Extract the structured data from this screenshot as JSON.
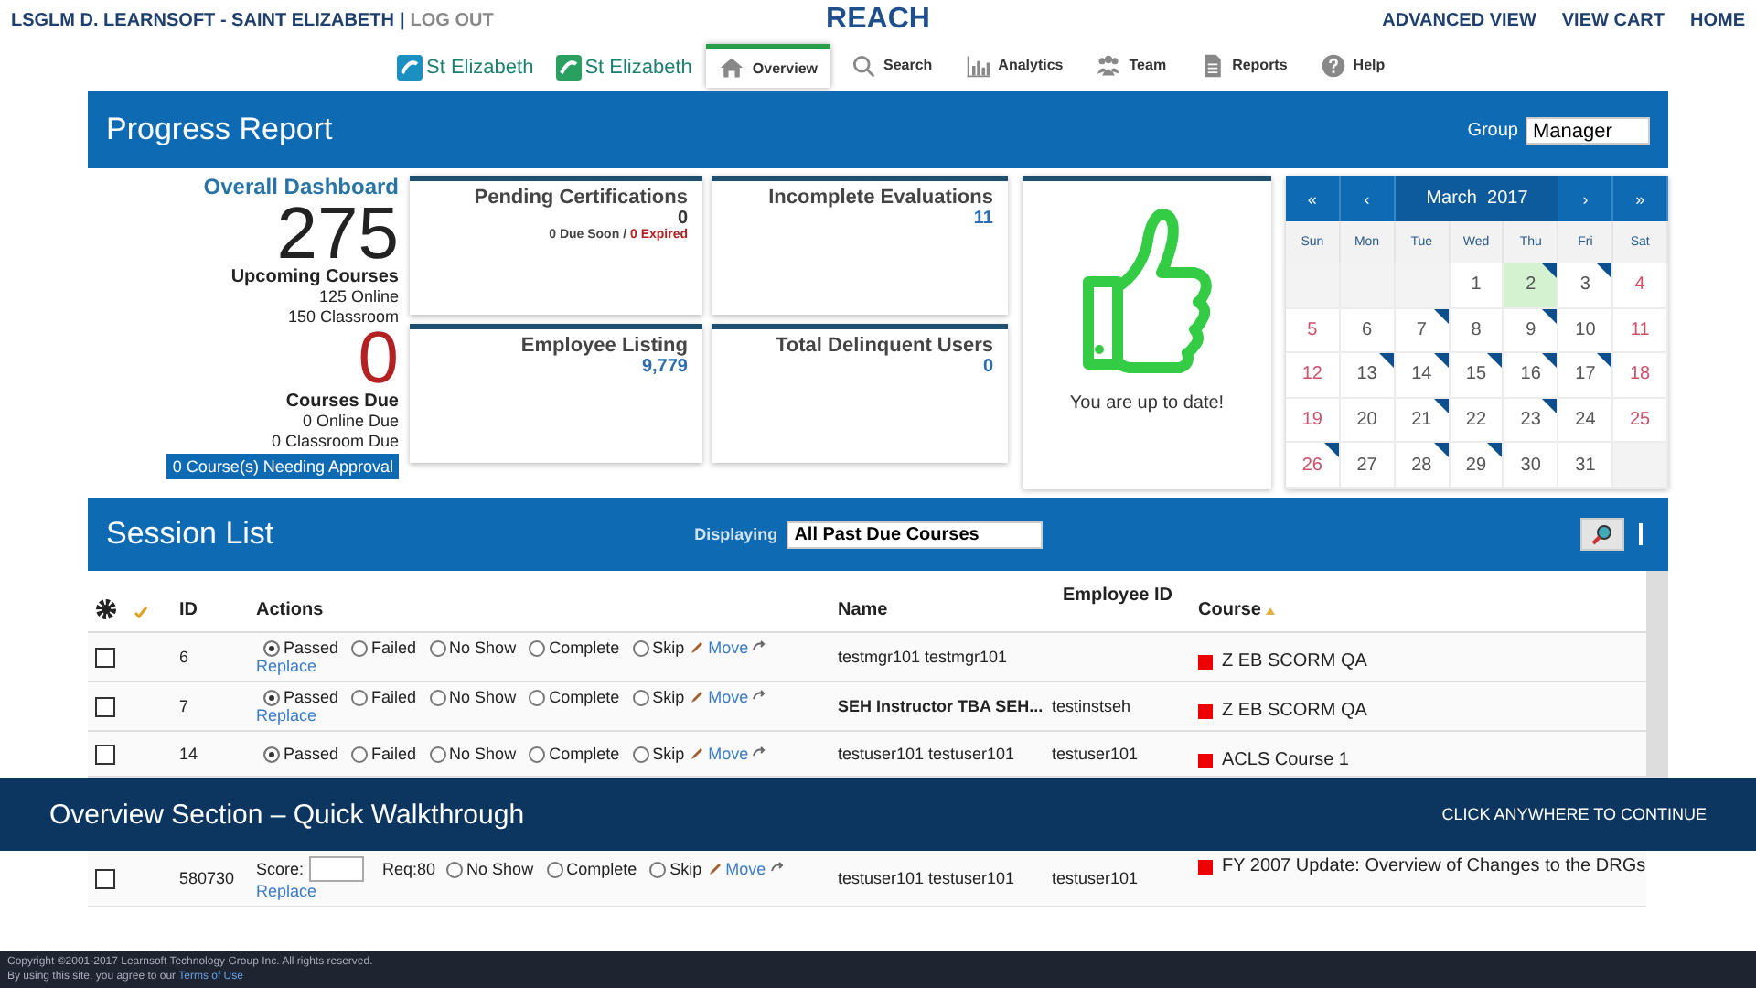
{
  "top_bar": {
    "user": "LSGLM D. LEARNSOFT - SAINT ELIZABETH",
    "separator": "|",
    "logout": "LOG OUT",
    "app_title": "REACH",
    "links": [
      "ADVANCED VIEW",
      "VIEW CART",
      "HOME"
    ]
  },
  "logos": [
    "St Elizabeth",
    "St Elizabeth"
  ],
  "nav": [
    {
      "label": "Overview",
      "kind": "home",
      "selected": true
    },
    {
      "label": "Search",
      "kind": "search",
      "selected": false
    },
    {
      "label": "Analytics",
      "kind": "chart",
      "selected": false
    },
    {
      "label": "Team",
      "kind": "team",
      "selected": false
    },
    {
      "label": "Reports",
      "kind": "document",
      "selected": false
    },
    {
      "label": "Help",
      "kind": "help",
      "selected": false
    }
  ],
  "progress_report": {
    "title": "Progress Report",
    "group_label": "Group",
    "group_value": "Manager"
  },
  "overall": {
    "title": "Overall Dashboard",
    "upcoming_count": "275",
    "upcoming_label": "Upcoming Courses",
    "online": "125 Online",
    "classroom": "150 Classroom",
    "due_count": "0",
    "due_label": "Courses Due",
    "online_due": "0 Online Due",
    "classroom_due": "0 Classroom Due",
    "approval": "0 Course(s) Needing Approval"
  },
  "cards": [
    {
      "title": "Pending Certifications",
      "value": "0",
      "kind": "plain",
      "due_soon": "0 Due Soon",
      "separator": "/",
      "expired": "0 Expired"
    },
    {
      "title": "Incomplete Evaluations",
      "value": "11",
      "kind": "link"
    },
    {
      "title": "Employee Listing",
      "value": "9,779",
      "kind": "link"
    },
    {
      "title": "Total Delinquent Users",
      "value": "0",
      "kind": "link"
    }
  ],
  "status": {
    "message": "You are up to date!"
  },
  "calendar": {
    "prev_year": "«",
    "prev": "‹",
    "month": "March  2017",
    "next": "›",
    "next_year": "»",
    "weekdays": [
      "Sun",
      "Mon",
      "Tue",
      "Wed",
      "Thu",
      "Fri",
      "Sat"
    ],
    "weeks": [
      [
        {
          "kind": "blank"
        },
        {
          "kind": "blank"
        },
        {
          "kind": "blank"
        },
        {
          "kind": "day",
          "day": "1",
          "marked": false,
          "today": false
        },
        {
          "kind": "day",
          "day": "2",
          "marked": true,
          "today": true
        },
        {
          "kind": "day",
          "day": "3",
          "marked": true,
          "today": false
        },
        {
          "kind": "day",
          "day": "4",
          "marked": false,
          "today": false
        }
      ],
      [
        {
          "kind": "day",
          "day": "5",
          "marked": false,
          "today": false
        },
        {
          "kind": "day",
          "day": "6",
          "marked": false,
          "today": false
        },
        {
          "kind": "day",
          "day": "7",
          "marked": true,
          "today": false
        },
        {
          "kind": "day",
          "day": "8",
          "marked": false,
          "today": false
        },
        {
          "kind": "day",
          "day": "9",
          "marked": true,
          "today": false
        },
        {
          "kind": "day",
          "day": "10",
          "marked": false,
          "today": false
        },
        {
          "kind": "day",
          "day": "11",
          "marked": false,
          "today": false
        }
      ],
      [
        {
          "kind": "day",
          "day": "12",
          "marked": false,
          "today": false
        },
        {
          "kind": "day",
          "day": "13",
          "marked": true,
          "today": false
        },
        {
          "kind": "day",
          "day": "14",
          "marked": true,
          "today": false
        },
        {
          "kind": "day",
          "day": "15",
          "marked": true,
          "today": false
        },
        {
          "kind": "day",
          "day": "16",
          "marked": true,
          "today": false
        },
        {
          "kind": "day",
          "day": "17",
          "marked": true,
          "today": false
        },
        {
          "kind": "day",
          "day": "18",
          "marked": false,
          "today": false
        }
      ],
      [
        {
          "kind": "day",
          "day": "19",
          "marked": false,
          "today": false
        },
        {
          "kind": "day",
          "day": "20",
          "marked": false,
          "today": false
        },
        {
          "kind": "day",
          "day": "21",
          "marked": true,
          "today": false
        },
        {
          "kind": "day",
          "day": "22",
          "marked": false,
          "today": false
        },
        {
          "kind": "day",
          "day": "23",
          "marked": true,
          "today": false
        },
        {
          "kind": "day",
          "day": "24",
          "marked": false,
          "today": false
        },
        {
          "kind": "day",
          "day": "25",
          "marked": false,
          "today": false
        }
      ],
      [
        {
          "kind": "day",
          "day": "26",
          "marked": true,
          "today": false
        },
        {
          "kind": "day",
          "day": "27",
          "marked": false,
          "today": false
        },
        {
          "kind": "day",
          "day": "28",
          "marked": true,
          "today": false
        },
        {
          "kind": "day",
          "day": "29",
          "marked": true,
          "today": false
        },
        {
          "kind": "day",
          "day": "30",
          "marked": false,
          "today": false
        },
        {
          "kind": "day",
          "day": "31",
          "marked": false,
          "today": false
        },
        {
          "kind": "blank"
        }
      ]
    ]
  },
  "session_list": {
    "title": "Session List",
    "displaying_label": "Displaying",
    "displaying_value": "All Past Due Courses",
    "columns": [
      "ID",
      "Actions",
      "Name",
      "Employee ID",
      "Course"
    ],
    "rows": [
      {
        "kind": "radios",
        "checked": false,
        "id": "6",
        "options": [
          {
            "label": "Passed",
            "selected": true
          },
          {
            "label": "Failed",
            "selected": false
          },
          {
            "label": "No Show",
            "selected": false
          },
          {
            "label": "Complete",
            "selected": false
          },
          {
            "label": "Skip",
            "selected": false
          }
        ],
        "move": "Move",
        "replace": "Replace",
        "name": "testmgr101 testmgr101",
        "course": "Z EB SCORM QA"
      },
      {
        "kind": "radios",
        "checked": false,
        "id": "7",
        "options": [
          {
            "label": "Passed",
            "selected": true
          },
          {
            "label": "Failed",
            "selected": false
          },
          {
            "label": "No Show",
            "selected": false
          },
          {
            "label": "Complete",
            "selected": false
          },
          {
            "label": "Skip",
            "selected": false
          }
        ],
        "move": "Move",
        "replace": "Replace",
        "name": "SEH Instructor TBA SEH...",
        "employee_id": "testinstseh",
        "course": "Z EB SCORM QA"
      },
      {
        "kind": "radios",
        "checked": false,
        "id": "14",
        "options": [
          {
            "label": "Passed",
            "selected": true
          },
          {
            "label": "Failed",
            "selected": false
          },
          {
            "label": "No Show",
            "selected": false
          },
          {
            "label": "Complete",
            "selected": false
          },
          {
            "label": "Skip",
            "selected": false
          }
        ],
        "move": "Move",
        "name": "testuser101 testuser101",
        "employee_id": "testuser101",
        "course": "ACLS Course 1"
      },
      {
        "kind": "score",
        "checked": false,
        "id": "580730",
        "score_label": "Score:",
        "requirement": "Req:80",
        "options": [
          {
            "label": "No Show",
            "selected": false
          },
          {
            "label": "Complete",
            "selected": false
          },
          {
            "label": "Skip",
            "selected": false
          }
        ],
        "move": "Move",
        "replace": "Replace",
        "name": "testuser101 testuser101",
        "employee_id": "testuser101",
        "course": "FY 2007 Update: Overview of Changes to the DRGs"
      }
    ]
  },
  "banner": {
    "title": "Overview Section – Quick Walkthrough",
    "action": "CLICK ANYWHERE TO CONTINUE"
  },
  "footer": {
    "copyright": "Copyright ©2001-2017 Learnsoft Technology Group Inc. All rights reserved.",
    "terms_prefix": "By using this site, you agree to our",
    "terms_link": "Terms of Use"
  }
}
